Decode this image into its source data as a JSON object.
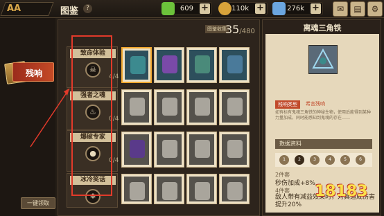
{
  "header": {
    "title": "图鉴",
    "help": "?",
    "logo": "AA"
  },
  "resources": [
    {
      "name": "green-cube",
      "value": "609",
      "color": "#6cc23b"
    },
    {
      "name": "gold-coin",
      "value": "110k",
      "color": "#d9a33a"
    },
    {
      "name": "blue-crystal",
      "value": "276k",
      "color": "#6ba6e0"
    }
  ],
  "top_buttons": [
    "mail",
    "backpack",
    "settings"
  ],
  "left_tab": {
    "label": "残响"
  },
  "one_key_button": "一键领取",
  "collection": {
    "label": "图鉴收集",
    "current": "35",
    "total": "/480"
  },
  "sets": [
    {
      "name": "致命体验",
      "count": "4/4"
    },
    {
      "name": "强者之魂",
      "count": "0/4"
    },
    {
      "name": "爆破专家",
      "count": "0/4"
    },
    {
      "name": "冰冷笑话",
      "count": ""
    }
  ],
  "detail": {
    "title": "离魂三角铁",
    "type_label": "残响类型",
    "type_value": "希言残响",
    "description": "如有标有鬼魂三角铁的神秘生物，使用后能得到某种力量加成，同时能感知到鬼魂的存在……",
    "data_header": "数据资料",
    "levels": [
      "1",
      "2",
      "3",
      "4",
      "5",
      "6"
    ],
    "piece2_label": "2件套",
    "piece2_effect": "秒伤加成+8%",
    "piece4_label": "4件套",
    "piece4_effect": "敌人带有减益效果时，对其造成伤害提升20%"
  },
  "watermark": "18183"
}
